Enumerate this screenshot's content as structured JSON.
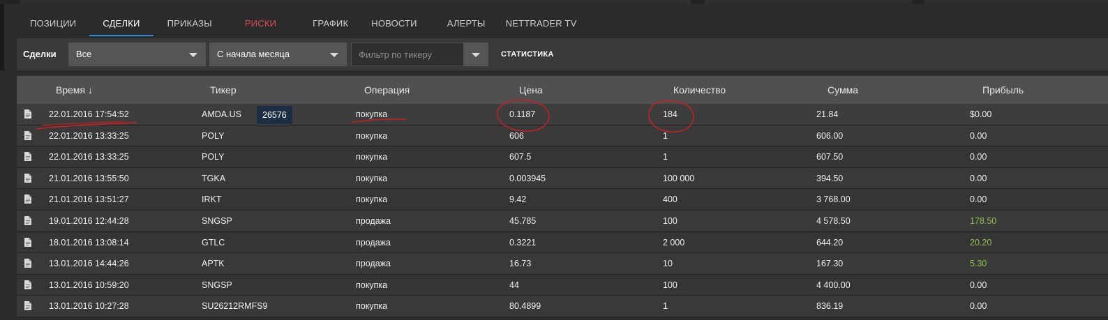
{
  "tabs": [
    {
      "label": "ПОЗИЦИИ"
    },
    {
      "label": "СДЕЛКИ"
    },
    {
      "label": "ПРИКАЗЫ"
    },
    {
      "label": "РИСКИ"
    },
    {
      "label": "ГРАФИК"
    },
    {
      "label": "НОВОСТИ"
    },
    {
      "label": "АЛЕРТЫ"
    },
    {
      "label": "NETTRADER TV"
    }
  ],
  "filters": {
    "label": "Сделки",
    "type_value": "Все",
    "period_value": "С начала месяца",
    "ticker_placeholder": "Фильтр по тикеру",
    "stats_label": "СТАТИСТИКА"
  },
  "columns": {
    "time": "Время ↓",
    "ticker": "Тикер",
    "operation": "Операция",
    "price": "Цена",
    "quantity": "Количество",
    "sum": "Сумма",
    "profit": "Прибыль"
  },
  "tooltip": "26576",
  "rows": [
    {
      "time": "22.01.2016 17:54:52",
      "ticker": "AMDA.US",
      "operation": "покупка",
      "price": "0.1187",
      "quantity": "184",
      "sum": "21.84",
      "profit": "$0.00"
    },
    {
      "time": "22.01.2016 13:33:25",
      "ticker": "POLY",
      "operation": "покупка",
      "price": "606",
      "quantity": "1",
      "sum": "606.00",
      "profit": "0.00"
    },
    {
      "time": "22.01.2016 13:33:25",
      "ticker": "POLY",
      "operation": "покупка",
      "price": "607.5",
      "quantity": "1",
      "sum": "607.50",
      "profit": "0.00"
    },
    {
      "time": "21.01.2016 13:55:50",
      "ticker": "TGKA",
      "operation": "покупка",
      "price": "0.003945",
      "quantity": "100 000",
      "sum": "394.50",
      "profit": "0.00"
    },
    {
      "time": "21.01.2016 13:51:27",
      "ticker": "IRKT",
      "operation": "покупка",
      "price": "9.42",
      "quantity": "400",
      "sum": "3 768.00",
      "profit": "0.00"
    },
    {
      "time": "19.01.2016 12:44:28",
      "ticker": "SNGSP",
      "operation": "продажа",
      "price": "45.785",
      "quantity": "100",
      "sum": "4 578.50",
      "profit": "178.50"
    },
    {
      "time": "18.01.2016 13:08:14",
      "ticker": "GTLC",
      "operation": "продажа",
      "price": "0.3221",
      "quantity": "2 000",
      "sum": "644.20",
      "profit": "20.20"
    },
    {
      "time": "13.01.2016 14:44:26",
      "ticker": "APTK",
      "operation": "продажа",
      "price": "16.73",
      "quantity": "10",
      "sum": "167.30",
      "profit": "5.30"
    },
    {
      "time": "13.01.2016 10:59:20",
      "ticker": "SNGSP",
      "operation": "покупка",
      "price": "44",
      "quantity": "100",
      "sum": "4 400.00",
      "profit": "0.00"
    },
    {
      "time": "13.01.2016 10:27:28",
      "ticker": "SU26212RMFS9",
      "operation": "покупка",
      "price": "80.4899",
      "quantity": "1",
      "sum": "836.19",
      "profit": "0.00"
    }
  ],
  "colors": {
    "active_tab_underline": "#2e87d8",
    "risk_tab": "#e04848",
    "positive_profit": "#8ec44a",
    "annotation": "#cc1f1f"
  },
  "icons": {
    "row_icon": "document-icon"
  }
}
